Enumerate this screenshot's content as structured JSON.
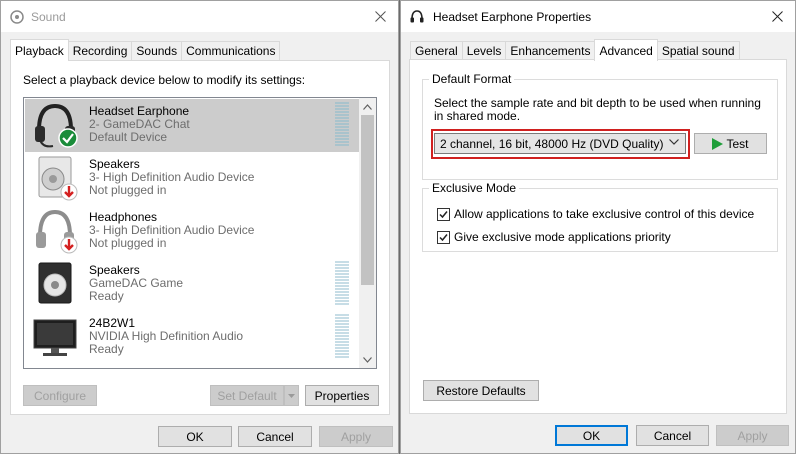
{
  "sound": {
    "title": "Sound",
    "tabs": [
      {
        "label": "Playback"
      },
      {
        "label": "Recording"
      },
      {
        "label": "Sounds"
      },
      {
        "label": "Communications"
      }
    ],
    "instruction": "Select a playback device below to modify its settings:",
    "devices": [
      {
        "name": "Headset Earphone",
        "line2": "2- GameDAC Chat",
        "line3": "Default Device",
        "status": "default",
        "selected": true
      },
      {
        "name": "Speakers",
        "line2": "3- High Definition Audio Device",
        "line3": "Not plugged in",
        "status": "unplugged"
      },
      {
        "name": "Headphones",
        "line2": "3- High Definition Audio Device",
        "line3": "Not plugged in",
        "status": "unplugged"
      },
      {
        "name": "Speakers",
        "line2": "GameDAC Game",
        "line3": "Ready",
        "status": "ready"
      },
      {
        "name": "24B2W1",
        "line2": "NVIDIA High Definition Audio",
        "line3": "Ready",
        "status": "ready"
      }
    ],
    "buttons": {
      "configure": "Configure",
      "set_default": "Set Default",
      "properties": "Properties",
      "ok": "OK",
      "cancel": "Cancel",
      "apply": "Apply"
    }
  },
  "props": {
    "title": "Headset Earphone Properties",
    "tabs": [
      {
        "label": "General"
      },
      {
        "label": "Levels"
      },
      {
        "label": "Enhancements"
      },
      {
        "label": "Advanced"
      },
      {
        "label": "Spatial sound"
      }
    ],
    "default_format": {
      "label": "Default Format",
      "desc_line1": "Select the sample rate and bit depth to be used when running",
      "desc_line2": "in shared mode.",
      "selected": "2 channel, 16 bit, 48000 Hz (DVD Quality)",
      "test_label": "Test"
    },
    "exclusive": {
      "label": "Exclusive Mode",
      "opt1": "Allow applications to take exclusive control of this device",
      "opt1_checked": true,
      "opt2": "Give exclusive mode applications priority",
      "opt2_checked": true
    },
    "buttons": {
      "restore": "Restore Defaults",
      "ok": "OK",
      "cancel": "Cancel",
      "apply": "Apply"
    }
  },
  "colors": {
    "accent": "#0078d7",
    "highlight_red": "#d0201f",
    "selected_row": "#cccccc",
    "check_green": "#1a8c3a",
    "unplugged_red": "#d42020"
  }
}
